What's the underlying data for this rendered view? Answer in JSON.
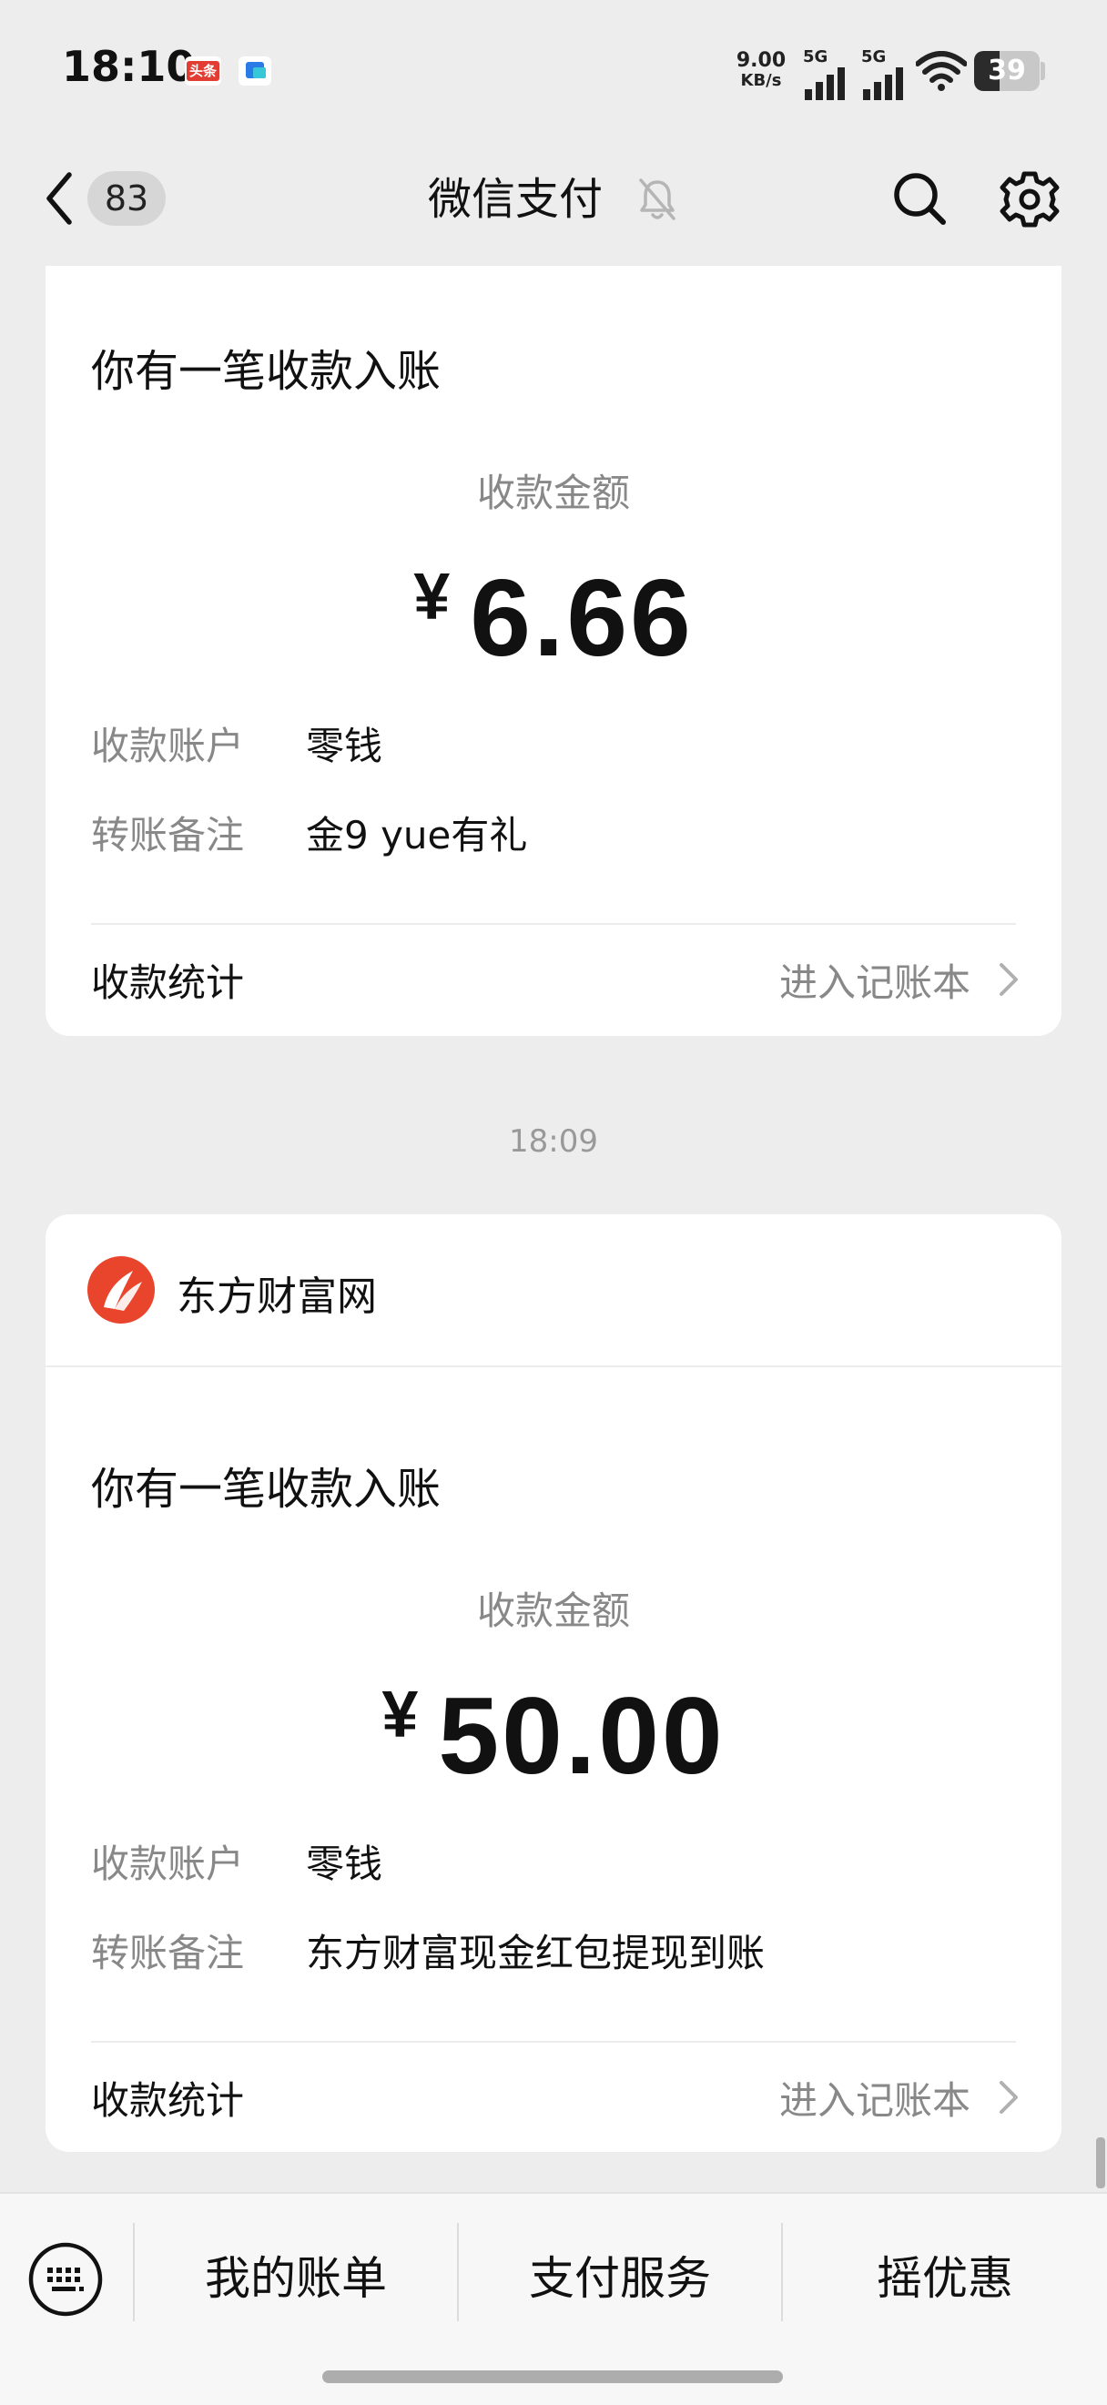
{
  "status_bar": {
    "time": "18:10",
    "notif_badge_1": "头条",
    "net_speed_value": "9.00",
    "net_speed_unit": "KB/s",
    "signal_1": "5G",
    "signal_2": "5G",
    "battery": "39",
    "battery_level": 0.39
  },
  "nav": {
    "unread_count": "83",
    "title": "微信支付"
  },
  "messages": [
    {
      "title": "你有一笔收款入账",
      "amount_label": "收款金额",
      "currency": "¥",
      "amount": "6.66",
      "account_label": "收款账户",
      "account_value": "零钱",
      "memo_label": "转账备注",
      "memo_value": "金9 yue有礼",
      "stats_label": "收款统计",
      "ledger_link": "进入记账本"
    },
    {
      "timestamp": "18:09",
      "brand_name": "东方财富网",
      "title": "你有一笔收款入账",
      "amount_label": "收款金额",
      "currency": "¥",
      "amount": "50.00",
      "account_label": "收款账户",
      "account_value": "零钱",
      "memo_label": "转账备注",
      "memo_value": "东方财富现金红包提现到账",
      "stats_label": "收款统计",
      "ledger_link": "进入记账本"
    }
  ],
  "bottom_menu": {
    "items": [
      "我的账单",
      "支付服务",
      "摇优惠"
    ]
  },
  "colors": {
    "background": "#ededed",
    "card": "#ffffff",
    "muted_text": "#888888",
    "brand_red": "#e8452c"
  }
}
